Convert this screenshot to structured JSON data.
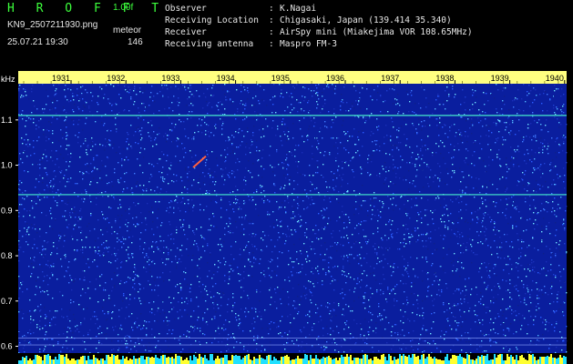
{
  "header": {
    "app_title": "H R O F F T",
    "version": "1.00f",
    "filename": "KN9_2507211930.png",
    "mode": "meteor",
    "datetime": "25.07.21 19:30",
    "count": "146"
  },
  "info": [
    {
      "label": "Observer",
      "sep": ":",
      "value": "K.Nagai"
    },
    {
      "label": "Receiving Location",
      "sep": ":",
      "value": "Chigasaki, Japan (139.414 35.340)"
    },
    {
      "label": "Receiver",
      "sep": ":",
      "value": "AirSpy mini (Miakejima VOR 108.65MHz)"
    },
    {
      "label": "Receiving antenna",
      "sep": ":",
      "value": "Maspro FM-3"
    }
  ],
  "axis": {
    "unit": "kHz",
    "y_ticks": [
      "1.1",
      "1.0",
      "0.9",
      "0.8",
      "0.7",
      "0.6"
    ],
    "time_labels": [
      "1931",
      "1932",
      "1933",
      "1934",
      "1935",
      "1936",
      "1937",
      "1938",
      "1939",
      "1940"
    ]
  },
  "colors": {
    "background": "#0a1e9e",
    "header_green": "#3cff3c",
    "time_bar": "#ffff80",
    "signal_line": "#3fd6c8"
  }
}
